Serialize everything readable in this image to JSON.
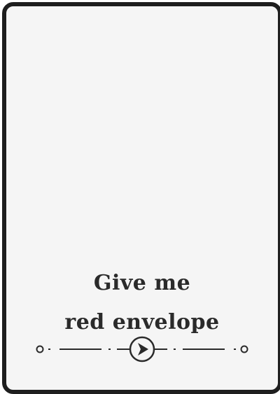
{
  "card": {
    "title_line1": "Give me",
    "title_line2": "red envelope",
    "play_icon": "play-icon",
    "colors": {
      "border": "#1e1e1e",
      "background": "#f5f5f5",
      "text": "#2a2a2a"
    }
  }
}
